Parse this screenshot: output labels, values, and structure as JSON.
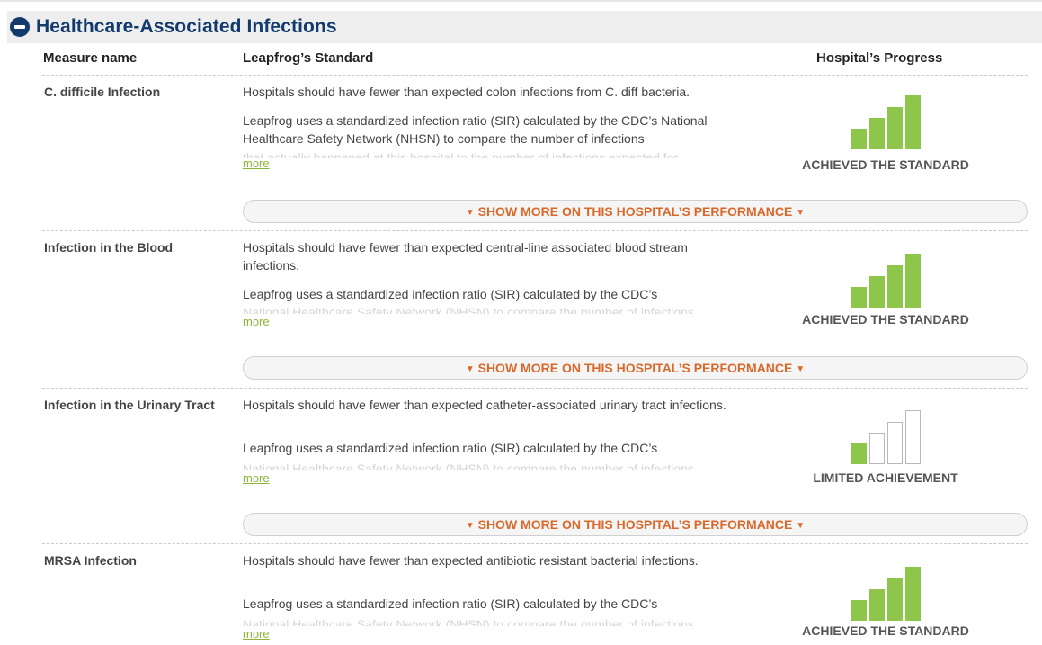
{
  "section": {
    "title": "Healthcare-Associated Infections"
  },
  "columns": {
    "measure": "Measure name",
    "standard": "Leapfrog’s Standard",
    "progress": "Hospital’s Progress"
  },
  "colors": {
    "title": "#123a6c",
    "bar_filled": "#8ec54b",
    "more_link": "#8cb53a",
    "show_more_text": "#d9692a"
  },
  "rows": [
    {
      "name": "C. difficile Infection",
      "standard": "Hospitals should have fewer than expected colon infections from C. diff bacteria.",
      "detail": "Leapfrog uses a standardized infection ratio (SIR) calculated by the CDC’s National Healthcare Safety Network (NHSN) to compare the number of infections",
      "detail_faded": "that actually happened at this hospital to the number of infections expected for",
      "more": "more",
      "progress_bars_filled": 4,
      "progress_bars_total": 4,
      "status": "ACHIEVED THE STANDARD",
      "show_more": "SHOW MORE ON THIS HOSPITAL’S PERFORMANCE"
    },
    {
      "name": "Infection in the Blood",
      "standard": "Hospitals should have fewer than expected central-line associated blood stream infections.",
      "detail": "Leapfrog uses a standardized infection ratio (SIR) calculated by the CDC’s",
      "detail_faded": "National Healthcare Safety Network (NHSN) to compare the number of infections",
      "more": "more",
      "progress_bars_filled": 4,
      "progress_bars_total": 4,
      "status": "ACHIEVED THE STANDARD",
      "show_more": "SHOW MORE ON THIS HOSPITAL’S PERFORMANCE"
    },
    {
      "name": "Infection in the Urinary Tract",
      "standard": "Hospitals should have fewer than expected catheter-associated urinary tract infections.",
      "detail": "Leapfrog uses a standardized infection ratio (SIR) calculated by the CDC’s",
      "detail_faded": "National Healthcare Safety Network (NHSN) to compare the number of infections",
      "more": "more",
      "progress_bars_filled": 1,
      "progress_bars_total": 4,
      "status": "LIMITED ACHIEVEMENT",
      "show_more": "SHOW MORE ON THIS HOSPITAL’S PERFORMANCE"
    },
    {
      "name": "MRSA Infection",
      "standard": "Hospitals should have fewer than expected antibiotic resistant bacterial infections.",
      "detail": "Leapfrog uses a standardized infection ratio (SIR) calculated by the CDC’s",
      "detail_faded": "National Healthcare Safety Network (NHSN) to compare the number of infections",
      "more": "more",
      "progress_bars_filled": 4,
      "progress_bars_total": 4,
      "status": "ACHIEVED THE STANDARD"
    }
  ]
}
